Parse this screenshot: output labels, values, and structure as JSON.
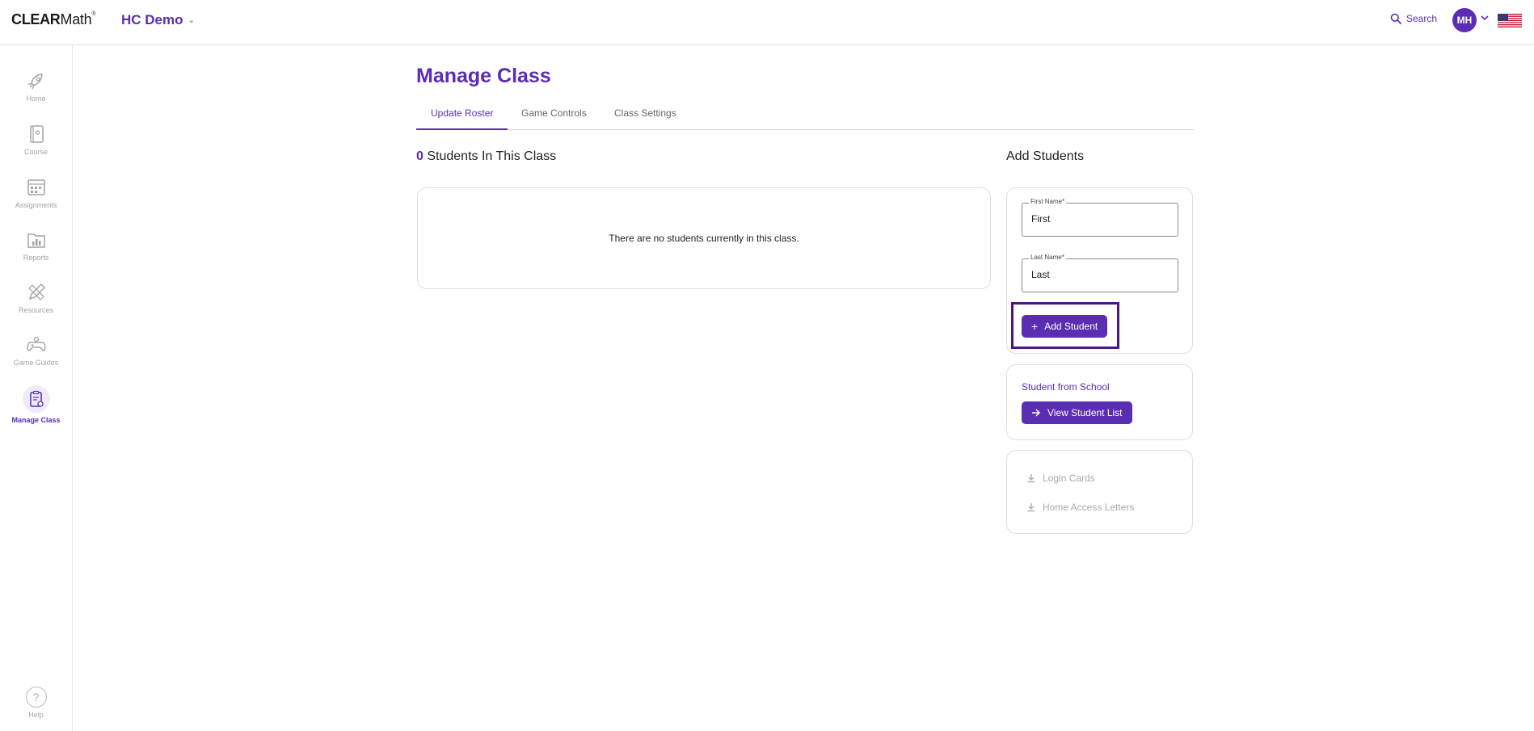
{
  "header": {
    "logo_main": "CLEAR",
    "logo_sub": "Math",
    "logo_tm": "®",
    "class_name": "HC Demo",
    "search_label": "Search",
    "avatar_initials": "MH"
  },
  "sidebar": {
    "items": [
      {
        "label": "Home",
        "icon": "rocket-icon"
      },
      {
        "label": "Course",
        "icon": "notebook-icon"
      },
      {
        "label": "Assignments",
        "icon": "calendar-icon"
      },
      {
        "label": "Reports",
        "icon": "chart-folder-icon"
      },
      {
        "label": "Resources",
        "icon": "pencil-ruler-icon"
      },
      {
        "label": "Game Guides",
        "icon": "gamepad-icon"
      },
      {
        "label": "Manage Class",
        "icon": "clipboard-gear-icon",
        "active": true
      }
    ],
    "help_label": "Help"
  },
  "main": {
    "title": "Manage Class",
    "tabs": [
      {
        "label": "Update Roster",
        "active": true
      },
      {
        "label": "Game Controls"
      },
      {
        "label": "Class Settings"
      }
    ],
    "student_count": "0",
    "students_heading": "Students In This Class",
    "empty_message": "There are no students currently in this class."
  },
  "add_students": {
    "heading": "Add Students",
    "first_name_label": "First Name*",
    "first_name_value": "First",
    "last_name_label": "Last Name*",
    "last_name_value": "Last",
    "add_button_label": "Add Student",
    "school_label": "Student from School",
    "view_list_label": "View Student List",
    "login_cards_label": "Login Cards",
    "home_access_label": "Home Access Letters"
  },
  "colors": {
    "accent": "#5b2db3",
    "highlight_border": "#4b1487"
  }
}
